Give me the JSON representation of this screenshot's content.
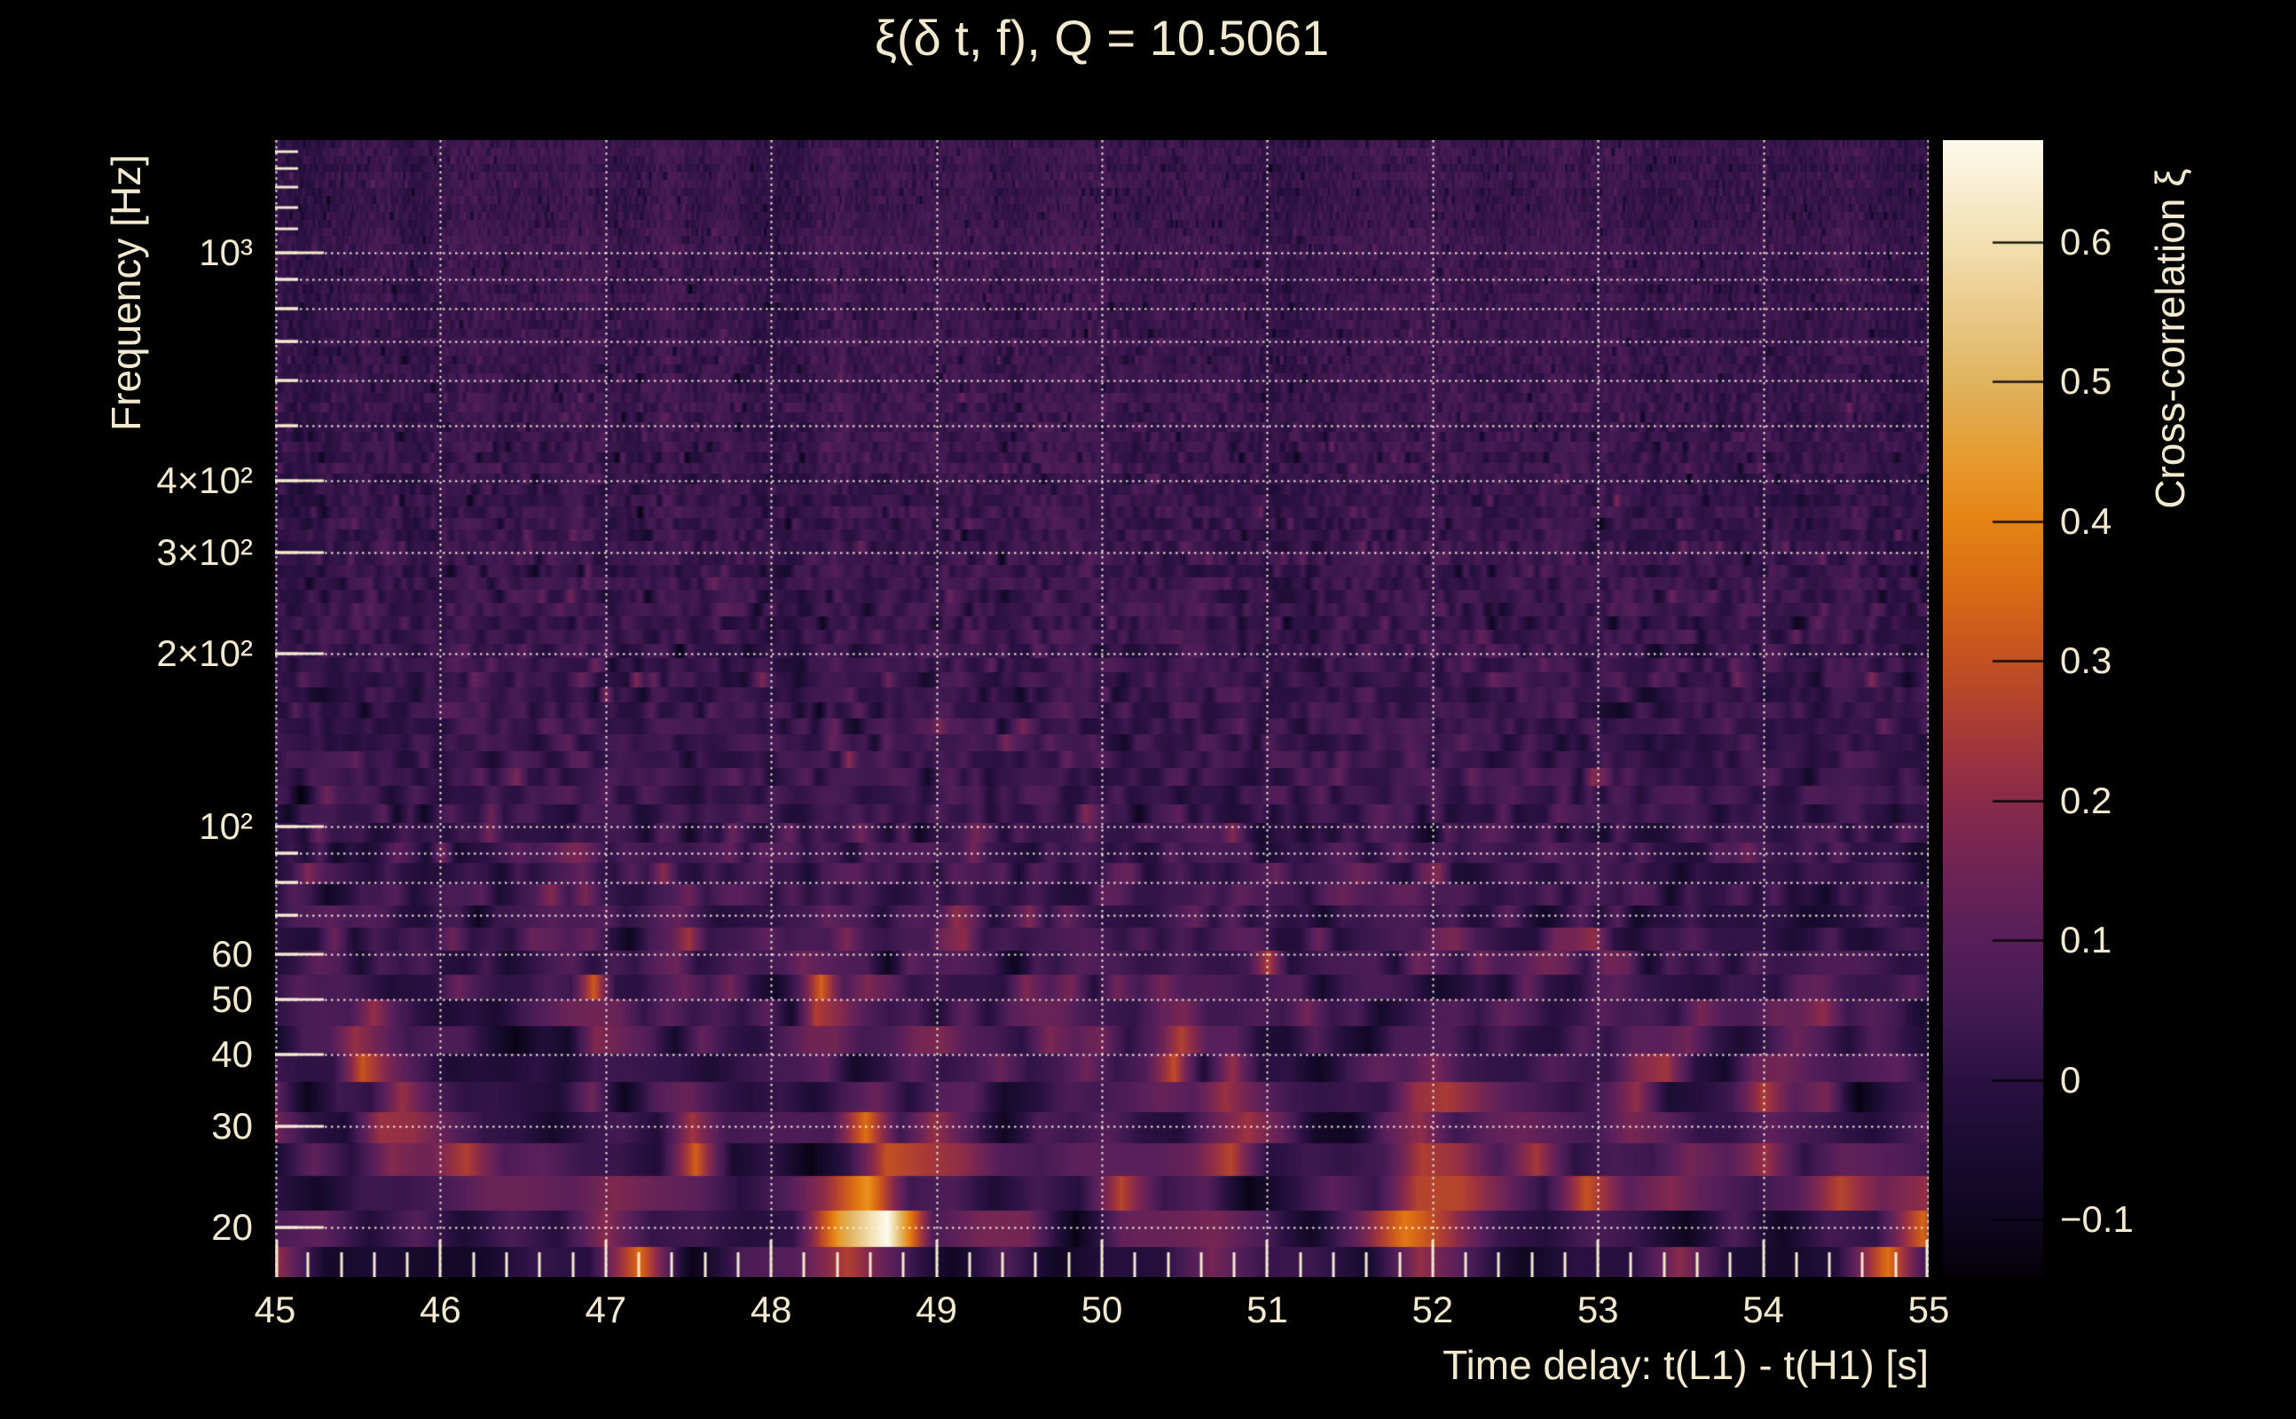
{
  "window": {
    "background": "#000000",
    "text_color": "#f3e9cf"
  },
  "chart_data": {
    "type": "heatmap",
    "title": "ξ(δ t, f), Q = 10.5061",
    "q_value": "10.5061",
    "xlabel": "Time delay: t(L1) - t(H1) [s]",
    "ylabel": "Frequency [Hz]",
    "x_range": [
      45,
      55
    ],
    "x_tick_labels": [
      "45",
      "46",
      "47",
      "48",
      "49",
      "50",
      "51",
      "52",
      "53",
      "54",
      "55"
    ],
    "x_tick_values": [
      45,
      46,
      47,
      48,
      49,
      50,
      51,
      52,
      53,
      54,
      55
    ],
    "x_minor_tick_step": 0.2,
    "y_scale": "log",
    "y_range_hz": [
      16.4,
      1570
    ],
    "y_ticks": [
      {
        "label": "10³",
        "value": 1000
      },
      {
        "label": "4×10²",
        "value": 400
      },
      {
        "label": "3×10²",
        "value": 300
      },
      {
        "label": "2×10²",
        "value": 200
      },
      {
        "label": "10²",
        "value": 100
      },
      {
        "label": "60",
        "value": 60
      },
      {
        "label": "50",
        "value": 50
      },
      {
        "label": "40",
        "value": 40
      },
      {
        "label": "30",
        "value": 30
      },
      {
        "label": "20",
        "value": 20
      }
    ],
    "y_minor_tick_frequencies": [
      70,
      80,
      90,
      500,
      600,
      700,
      800,
      900,
      1100,
      1200,
      1300,
      1400,
      1500
    ],
    "gridline_frequencies": [
      20,
      30,
      40,
      50,
      60,
      70,
      80,
      90,
      100,
      200,
      300,
      400,
      500,
      600,
      700,
      800,
      900,
      1000
    ],
    "grid_on": true,
    "colorbar": {
      "label": "Cross-correlation ξ",
      "min": -0.141,
      "max": 0.673,
      "ticks": [
        {
          "label": "0.6",
          "value": 0.6
        },
        {
          "label": "0.5",
          "value": 0.5
        },
        {
          "label": "0.4",
          "value": 0.4
        },
        {
          "label": "0.3",
          "value": 0.3
        },
        {
          "label": "0.2",
          "value": 0.2
        },
        {
          "label": "0.1",
          "value": 0.1
        },
        {
          "label": "0",
          "value": 0.0
        },
        {
          "label": "−0.1",
          "value": -0.1
        }
      ]
    },
    "colormap_stops": [
      [
        0.0,
        "#060109"
      ],
      [
        0.055,
        "#100722"
      ],
      [
        0.11,
        "#190c30"
      ],
      [
        0.173,
        "#2b1142"
      ],
      [
        0.235,
        "#431a52"
      ],
      [
        0.296,
        "#571f5a"
      ],
      [
        0.357,
        "#6e2455"
      ],
      [
        0.419,
        "#8a2b4b"
      ],
      [
        0.48,
        "#a83a37"
      ],
      [
        0.542,
        "#c45122"
      ],
      [
        0.603,
        "#d96a16"
      ],
      [
        0.665,
        "#e68414"
      ],
      [
        0.726,
        "#e69d33"
      ],
      [
        0.787,
        "#e0b45f"
      ],
      [
        0.849,
        "#eaca8a"
      ],
      [
        0.91,
        "#f3e0b2"
      ],
      [
        1.0,
        "#fdfaed"
      ]
    ],
    "background_correlation_level": 0.03,
    "peak_correlation": 0.67,
    "peak_location": {
      "time_delay_s": 48.65,
      "frequency_hz": 20.5
    },
    "features": [
      {
        "t": 48.65,
        "f": 20.5,
        "amp": 0.62,
        "st": 0.1,
        "slf": 0.055
      },
      {
        "t": 48.6,
        "f": 28,
        "amp": 0.22,
        "st": 0.1,
        "slf": 0.05
      },
      {
        "t": 48.45,
        "f": 18.5,
        "amp": 0.28,
        "st": 0.14,
        "slf": 0.05
      },
      {
        "t": 48.33,
        "f": 21,
        "amp": 0.22,
        "st": 0.08,
        "slf": 0.05
      },
      {
        "t": 51.95,
        "f": 20.5,
        "amp": 0.42,
        "st": 0.1,
        "slf": 0.055
      },
      {
        "t": 52.08,
        "f": 25,
        "amp": 0.28,
        "st": 0.1,
        "slf": 0.05
      },
      {
        "t": 51.78,
        "f": 17,
        "amp": 0.25,
        "st": 0.1,
        "slf": 0.05
      },
      {
        "t": 47.15,
        "f": 16.8,
        "amp": 0.4,
        "st": 0.12,
        "slf": 0.05
      },
      {
        "t": 45.08,
        "f": 16.8,
        "amp": 0.38,
        "st": 0.1,
        "slf": 0.05
      },
      {
        "t": 54.78,
        "f": 16.8,
        "amp": 0.45,
        "st": 0.12,
        "slf": 0.05
      },
      {
        "t": 54.88,
        "f": 21,
        "amp": 0.3,
        "st": 0.08,
        "slf": 0.05
      },
      {
        "t": 53.95,
        "f": 17,
        "amp": 0.26,
        "st": 0.1,
        "slf": 0.05
      },
      {
        "t": 45.75,
        "f": 30,
        "amp": 0.26,
        "st": 0.13,
        "slf": 0.07
      },
      {
        "t": 46.18,
        "f": 27,
        "amp": 0.2,
        "st": 0.1,
        "slf": 0.06
      },
      {
        "t": 47.0,
        "f": 45,
        "amp": 0.18,
        "st": 0.08,
        "slf": 0.06
      },
      {
        "t": 47.45,
        "f": 62,
        "amp": 0.2,
        "st": 0.06,
        "slf": 0.05
      },
      {
        "t": 47.55,
        "f": 23,
        "amp": 0.2,
        "st": 0.08,
        "slf": 0.05
      },
      {
        "t": 48.28,
        "f": 48,
        "amp": 0.22,
        "st": 0.08,
        "slf": 0.06
      },
      {
        "t": 49.0,
        "f": 26,
        "amp": 0.26,
        "st": 0.09,
        "slf": 0.05
      },
      {
        "t": 49.15,
        "f": 65,
        "amp": 0.16,
        "st": 0.05,
        "slf": 0.05
      },
      {
        "t": 49.35,
        "f": 19,
        "amp": 0.18,
        "st": 0.08,
        "slf": 0.05
      },
      {
        "t": 50.15,
        "f": 21,
        "amp": 0.2,
        "st": 0.08,
        "slf": 0.05
      },
      {
        "t": 50.45,
        "f": 45,
        "amp": 0.22,
        "st": 0.08,
        "slf": 0.06
      },
      {
        "t": 50.8,
        "f": 33,
        "amp": 0.24,
        "st": 0.1,
        "slf": 0.06
      },
      {
        "t": 51.0,
        "f": 57,
        "amp": 0.22,
        "st": 0.06,
        "slf": 0.05
      },
      {
        "t": 52.0,
        "f": 32,
        "amp": 0.24,
        "st": 0.1,
        "slf": 0.06
      },
      {
        "t": 52.5,
        "f": 26,
        "amp": 0.2,
        "st": 0.1,
        "slf": 0.06
      },
      {
        "t": 53.3,
        "f": 36,
        "amp": 0.2,
        "st": 0.1,
        "slf": 0.06
      },
      {
        "t": 53.35,
        "f": 22,
        "amp": 0.18,
        "st": 0.1,
        "slf": 0.05
      },
      {
        "t": 54.05,
        "f": 30,
        "amp": 0.24,
        "st": 0.12,
        "slf": 0.06
      },
      {
        "t": 46.6,
        "f": 21,
        "amp": 0.18,
        "st": 0.08,
        "slf": 0.05
      },
      {
        "t": 45.3,
        "f": 55,
        "amp": 0.14,
        "st": 0.06,
        "slf": 0.05
      },
      {
        "t": 46.9,
        "f": 80,
        "amp": 0.13,
        "st": 0.05,
        "slf": 0.04
      },
      {
        "t": 49.7,
        "f": 47,
        "amp": 0.16,
        "st": 0.07,
        "slf": 0.05
      },
      {
        "t": 53.0,
        "f": 60,
        "amp": 0.13,
        "st": 0.05,
        "slf": 0.04
      },
      {
        "t": 54.3,
        "f": 45,
        "amp": 0.16,
        "st": 0.07,
        "slf": 0.05
      },
      {
        "t": 45.55,
        "f": 42,
        "amp": 0.16,
        "st": 0.07,
        "slf": 0.05
      },
      {
        "t": 48.05,
        "f": 95,
        "amp": 0.12,
        "st": 0.06,
        "slf": 0.04
      },
      {
        "t": 50.55,
        "f": 20,
        "amp": 0.18,
        "st": 0.08,
        "slf": 0.05
      },
      {
        "t": 47.53,
        "f": 30,
        "amp": 0.18,
        "st": 0.06,
        "slf": 0.05
      }
    ]
  }
}
